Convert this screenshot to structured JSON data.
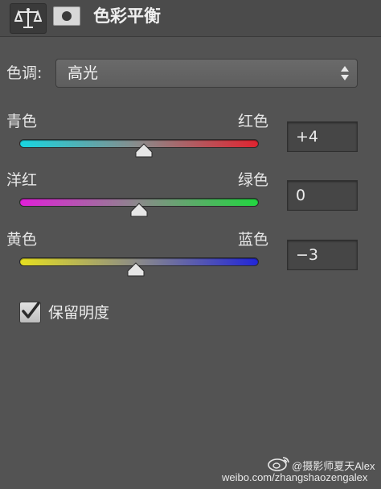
{
  "header": {
    "title": "色彩平衡",
    "adjustment_icon": "balance-scale-icon",
    "mask_icon": "layer-mask-icon"
  },
  "tone": {
    "label": "色调:",
    "selected": "高光",
    "options_icon": "up-down-arrows-icon"
  },
  "sliders": [
    {
      "left_label": "青色",
      "right_label": "红色",
      "value": "+4",
      "numeric": 4,
      "range": [
        -100,
        100
      ],
      "gradient": [
        "#18d6e0",
        "#e02430"
      ]
    },
    {
      "left_label": "洋红",
      "right_label": "绿色",
      "value": "0",
      "numeric": 0,
      "range": [
        -100,
        100
      ],
      "gradient": [
        "#e020d8",
        "#22d640"
      ]
    },
    {
      "left_label": "黄色",
      "right_label": "蓝色",
      "value": "−3",
      "numeric": -3,
      "range": [
        -100,
        100
      ],
      "gradient": [
        "#e6e020",
        "#2226d8"
      ]
    }
  ],
  "preserve": {
    "label": "保留明度",
    "checked": true
  },
  "watermark": {
    "line1": "@摄影师夏天Alex",
    "line2": "weibo.com/zhangshaozengalex",
    "icon": "weibo-icon"
  }
}
